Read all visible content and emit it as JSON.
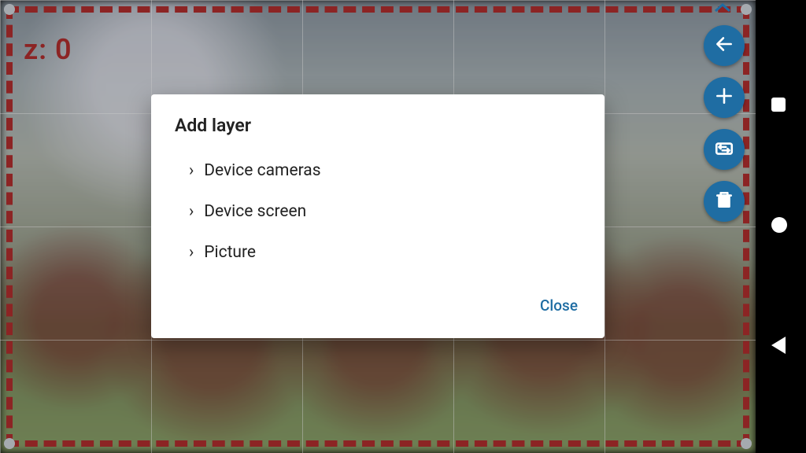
{
  "canvas": {
    "z_label": "z: 0"
  },
  "fab": {
    "back": "back",
    "add": "add",
    "swap": "flip-camera",
    "delete": "delete"
  },
  "dialog": {
    "title": "Add layer",
    "items": [
      {
        "label": "Device cameras"
      },
      {
        "label": "Device screen"
      },
      {
        "label": "Picture"
      }
    ],
    "close": "Close"
  },
  "nav": {
    "overview": "overview",
    "home": "home",
    "back": "back"
  }
}
